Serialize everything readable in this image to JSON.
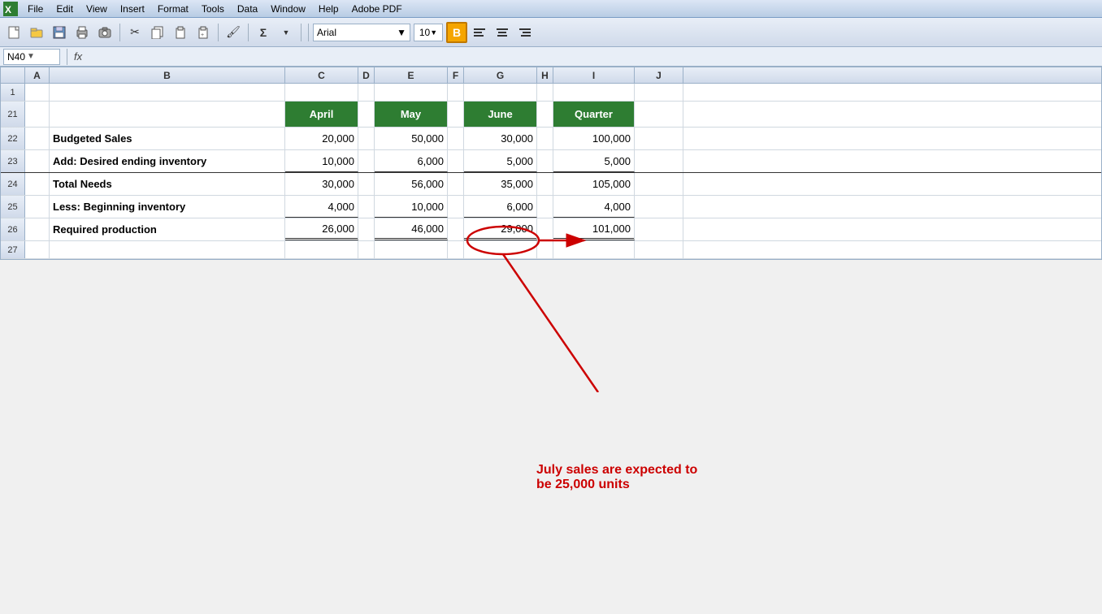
{
  "menubar": {
    "items": [
      "File",
      "Edit",
      "View",
      "Insert",
      "Format",
      "Tools",
      "Data",
      "Window",
      "Help",
      "Adobe PDF"
    ]
  },
  "toolbar": {
    "font": "Arial",
    "size": "10",
    "bold_label": "B"
  },
  "formula_bar": {
    "cell_ref": "N40",
    "fx": "fx"
  },
  "column_headers": [
    "A",
    "B",
    "C",
    "D",
    "E",
    "F",
    "G",
    "H",
    "I",
    "J"
  ],
  "rows": {
    "row1": {
      "num": "1",
      "data": []
    },
    "row21": {
      "num": "21",
      "headers": [
        {
          "col": "c",
          "label": "April",
          "style": "header-green"
        },
        {
          "col": "e",
          "label": "May",
          "style": "header-green"
        },
        {
          "col": "g",
          "label": "June",
          "style": "header-green"
        },
        {
          "col": "i",
          "label": "Quarter",
          "style": "header-green"
        }
      ]
    },
    "row22": {
      "num": "22",
      "label": "Budgeted Sales",
      "april": "20,000",
      "may": "50,000",
      "june": "30,000",
      "quarter": "100,000"
    },
    "row23": {
      "num": "23",
      "label": "Add: Desired ending inventory",
      "april": "10,000",
      "may": "6,000",
      "june": "5,000",
      "quarter": "5,000"
    },
    "row24": {
      "num": "24",
      "label": "Total Needs",
      "april": "30,000",
      "may": "56,000",
      "june": "35,000",
      "quarter": "105,000"
    },
    "row25": {
      "num": "25",
      "label": "Less: Beginning inventory",
      "april": "4,000",
      "may": "10,000",
      "june": "6,000",
      "quarter": "4,000"
    },
    "row26": {
      "num": "26",
      "label": "Required production",
      "april": "26,000",
      "may": "46,000",
      "june": "29,000",
      "quarter": "101,000"
    },
    "row27": {
      "num": "27"
    }
  },
  "annotation": {
    "text_line1": "July sales are expected to",
    "text_line2": "be 25,000 units"
  }
}
